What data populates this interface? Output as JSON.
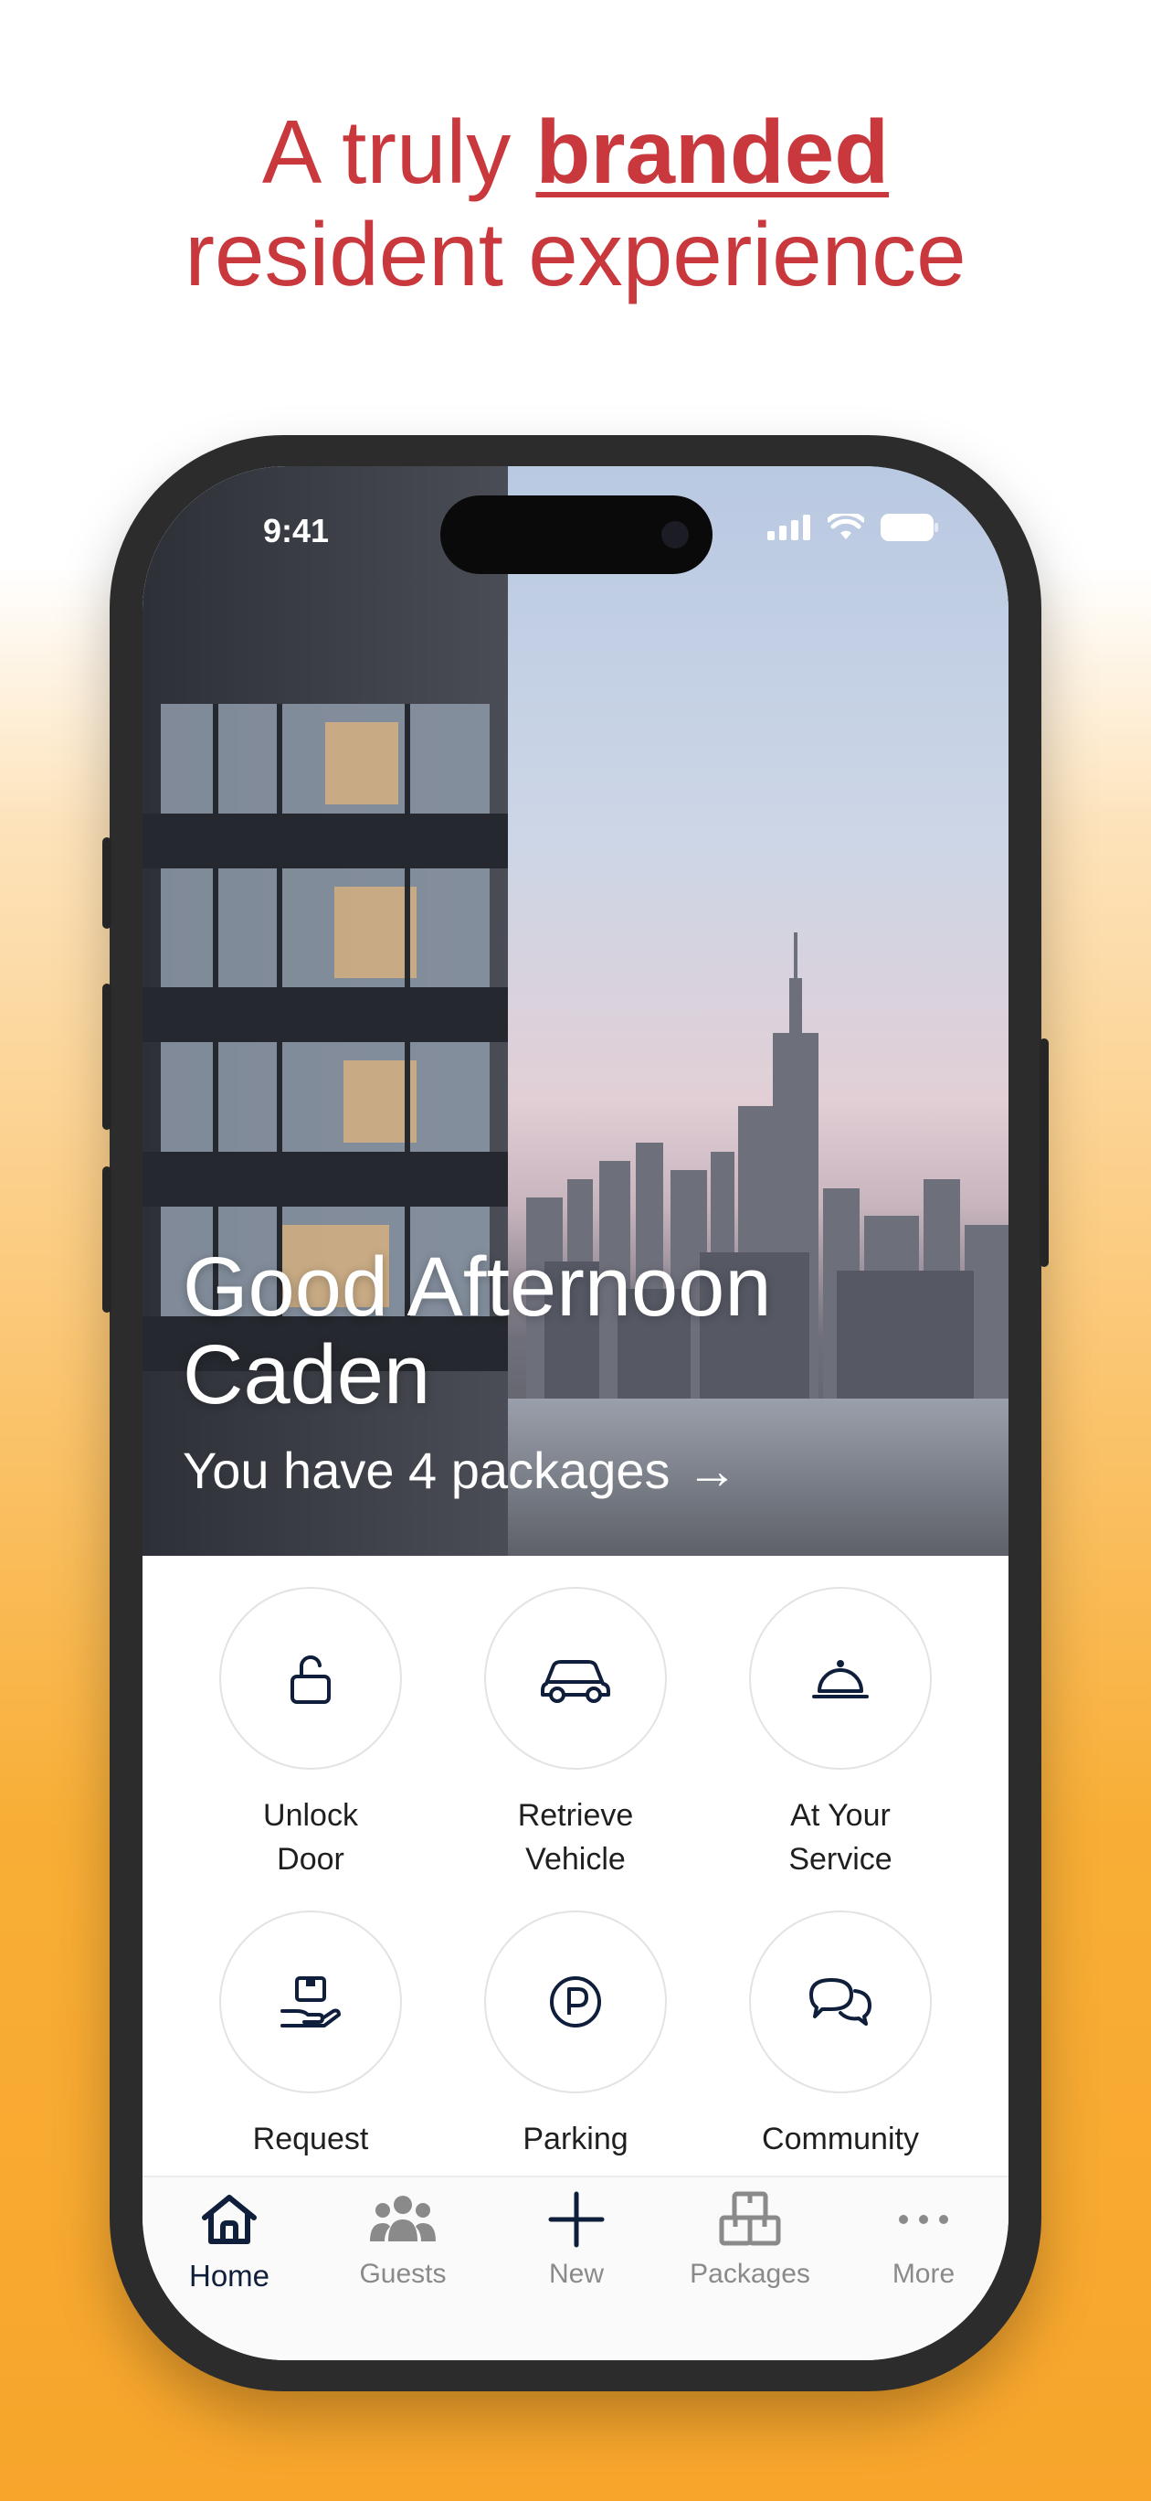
{
  "headline": {
    "line1_prefix": "A truly ",
    "line1_bold": "branded",
    "line2": "resident experience"
  },
  "colors": {
    "headline": "#c8383d",
    "icon_dark": "#0f1e3a",
    "tab_inactive": "#8a8a8a"
  },
  "status_bar": {
    "time": "9:41"
  },
  "hero": {
    "greeting_line1": "Good Afternoon",
    "greeting_line2": "Caden",
    "packages_text": "You have 4 packages",
    "arrow": "→"
  },
  "actions": [
    {
      "line1": "Unlock",
      "line2": "Door",
      "icon": "unlock-icon"
    },
    {
      "line1": "Retrieve",
      "line2": "Vehicle",
      "icon": "car-icon"
    },
    {
      "line1": "At Your",
      "line2": "Service",
      "icon": "service-bell-icon"
    },
    {
      "line1": "Request",
      "line2": "",
      "icon": "package-hand-icon"
    },
    {
      "line1": "Parking",
      "line2": "",
      "icon": "parking-icon"
    },
    {
      "line1": "Community",
      "line2": "",
      "icon": "chat-bubbles-icon"
    }
  ],
  "tabs": [
    {
      "label": "Home",
      "icon": "home-icon",
      "active": true
    },
    {
      "label": "Guests",
      "icon": "guests-icon",
      "active": false
    },
    {
      "label": "New",
      "icon": "plus-icon",
      "active": false
    },
    {
      "label": "Packages",
      "icon": "packages-icon",
      "active": false
    },
    {
      "label": "More",
      "icon": "more-icon",
      "active": false
    }
  ]
}
